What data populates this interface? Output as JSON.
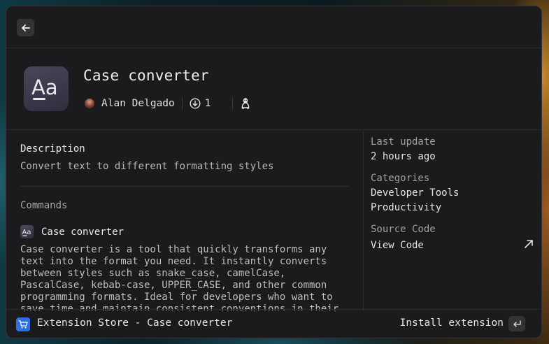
{
  "extension": {
    "title": "Case converter",
    "icon_text": "Aa",
    "author": "Alan Delgado",
    "downloads": "1",
    "platform_icon": "linux-icon"
  },
  "nav": {
    "back_icon": "arrow-left-icon"
  },
  "description": {
    "heading": "Description",
    "text": "Convert text to different formatting styles"
  },
  "commands": {
    "heading": "Commands",
    "items": [
      {
        "name": "Case converter",
        "icon_text": "Aa",
        "description": "Case converter is a tool that quickly transforms any text into the format you need. It instantly converts between styles such as snake_case, camelCase, PascalCase, kebab-case, UPPER_CASE, and other common programming formats. Ideal for developers who want to save time and maintain consistent conventions in their"
      }
    ]
  },
  "sidebar": {
    "last_update_label": "Last update",
    "last_update_value": "2 hours ago",
    "categories_label": "Categories",
    "categories": [
      "Developer Tools",
      "Productivity"
    ],
    "source_label": "Source Code",
    "source_link": "View Code"
  },
  "footer": {
    "title": "Extension Store - Case converter",
    "action_label": "Install extension",
    "store_icon": "cart-icon",
    "enter_icon": "return-key-icon"
  },
  "colors": {
    "store_icon_bg": "#2f6fe0",
    "window_bg": "#1b1b1d"
  }
}
